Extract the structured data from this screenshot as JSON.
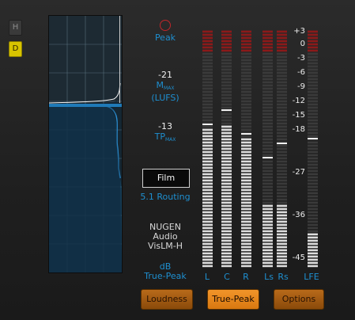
{
  "side_buttons": {
    "h": "H",
    "d": "D"
  },
  "peak": {
    "label": "Peak"
  },
  "loudness_max": {
    "value": "-21",
    "label_main": "M",
    "label_sub": "MAX",
    "unit": "(LUFS)"
  },
  "true_peak_max": {
    "value": "-13",
    "label_main": "TP",
    "label_sub": "MAX"
  },
  "format_button": "Film",
  "routing": "5.1 Routing",
  "product": [
    "NUGEN",
    "Audio",
    "VisLM-H"
  ],
  "units": [
    "dB",
    "True-Peak"
  ],
  "channels": [
    {
      "name": "L",
      "level_db": -18,
      "peak_hold_db": -17
    },
    {
      "name": "C",
      "level_db": -17,
      "peak_hold_db": -14
    },
    {
      "name": "R",
      "level_db": -20,
      "peak_hold_db": -19
    },
    {
      "name": "Ls",
      "level_db": -34,
      "peak_hold_db": -24
    },
    {
      "name": "Rs",
      "level_db": -34,
      "peak_hold_db": -21
    },
    {
      "name": "LFE",
      "level_db": -40,
      "peak_hold_db": -20
    }
  ],
  "scale": [
    "+3",
    "0",
    "-3",
    "-6",
    "-9",
    "-12",
    "-15",
    "-18",
    "-27",
    "-36",
    "-45"
  ],
  "bottom_buttons": {
    "loudness": "Loudness",
    "true_peak": "True-Peak",
    "options": "Options"
  },
  "colors": {
    "accent": "#1e8fd0",
    "button": "#e8861c",
    "led_lit": "#dcdcdc",
    "led_dim": "#3a3a3a",
    "led_red": "#8b1a1a"
  }
}
